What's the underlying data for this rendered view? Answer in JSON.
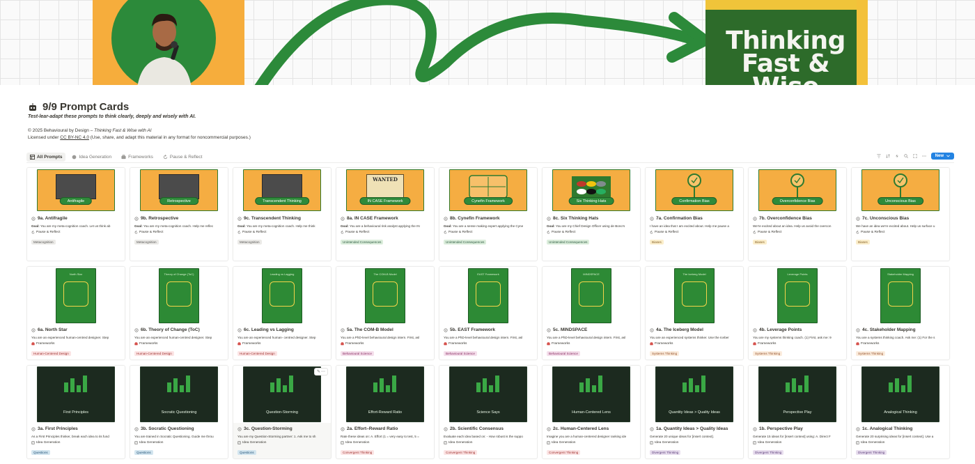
{
  "banner": {
    "book_title_1": "Thinking",
    "book_title_2": "Fast & Wise"
  },
  "page": {
    "title": "9/9 Prompt Cards",
    "subtitle": "Test-lear-adapt these prompts to think clearly, deeply and wisely with AI.",
    "copyright_prefix": "© 2025 Behavioural by Design – ",
    "copyright_book": "Thinking Fast & Wise with AI",
    "license_prefix": "Licensed under ",
    "license_link": "CC BY-NC 4.0",
    "license_suffix": " (Use, share, and adapt this material in any format for noncommercial purposes.)"
  },
  "tabs": [
    {
      "label": "All Prompts",
      "icon": "table-icon"
    },
    {
      "label": "Idea Generation",
      "icon": "idea-icon"
    },
    {
      "label": "Frameworks",
      "icon": "frameworks-icon"
    },
    {
      "label": "Pause & Reflect",
      "icon": "refresh-icon"
    }
  ],
  "toolbar": {
    "new_label": "New"
  },
  "cards": [
    {
      "art": "orange-photo",
      "art_label": "Antifragile",
      "title": "9a. Antifragile",
      "desc_bold": "Goal:",
      "desc": " You are my meta-cognition coach. Let us think ab",
      "category": "Pause & Reflect",
      "tag": "Metacognition",
      "tag_color": "gray"
    },
    {
      "art": "orange-photo",
      "art_label": "Retrospective",
      "title": "9b. Retrospective",
      "desc_bold": "Goal:",
      "desc": " You are my meta-cognition coach. Help me reflec",
      "category": "Pause & Reflect",
      "tag": "Metacognition",
      "tag_color": "gray"
    },
    {
      "art": "orange-photo",
      "art_label": "Transcendent Thinking",
      "title": "9c. Transcendent Thinking",
      "desc_bold": "Goal:",
      "desc": " You are my meta-cognition coach. Help me think",
      "category": "Pause & Reflect",
      "tag": "Metacognition",
      "tag_color": "gray"
    },
    {
      "art": "orange-wanted",
      "art_label": "IN CASE Framework",
      "art_top": "WANTED",
      "title": "8a. IN CASE Framework",
      "desc_bold": "Goal:",
      "desc": " You are a behavioural risk analyst applying the IN",
      "category": "Pause & Reflect",
      "tag": "Unintended Consequences",
      "tag_color": "green"
    },
    {
      "art": "orange-grid",
      "art_label": "Cynefin Framework",
      "title": "8b. Cynefin Framework",
      "desc_bold": "Goal:",
      "desc": " You are a sense making expert applying the Cyne",
      "category": "Pause & Reflect",
      "tag": "Unintended Consequences",
      "tag_color": "green"
    },
    {
      "art": "orange-hats",
      "art_label": "Six Thinking Hats",
      "title": "8c. Six Thinking Hats",
      "desc_bold": "Goal:",
      "desc": " You are my Chief Design Officer using de Bono's",
      "category": "Pause & Reflect",
      "tag": "Unintended Consequences",
      "tag_color": "green"
    },
    {
      "art": "orange-mirror",
      "art_label": "Confirmation Bias",
      "title": "7a. Confirmation Bias",
      "desc_bold": "",
      "desc": "I have an idea that I am excited about. Help me pause a",
      "category": "Pause & Reflect",
      "tag": "Biases",
      "tag_color": "yellow"
    },
    {
      "art": "orange-mirror",
      "art_label": "Overconfidence Bias",
      "title": "7b. Overconfidence Bias",
      "desc_bold": "",
      "desc": "We're excited about an idea. Help us avoid the overcon",
      "category": "Pause & Reflect",
      "tag": "Biases",
      "tag_color": "yellow"
    },
    {
      "art": "orange-mirror",
      "art_label": "Unconscious Bias",
      "title": "7c. Unconscious Bias",
      "desc_bold": "",
      "desc": "We have an idea we're excited about. Help us surface u",
      "category": "Pause & Reflect",
      "tag": "Biases",
      "tag_color": "yellow"
    },
    {
      "art": "green",
      "art_label": "North Star",
      "title": "6a. North Star",
      "desc_bold": "",
      "desc": "You are an experienced human-centred designer. Step",
      "category": "Frameworks",
      "tag": "Human-Centered Design",
      "tag_color": "red"
    },
    {
      "art": "green",
      "art_label": "Theory of Change (ToC)",
      "title": "6b. Theory of Change (ToC)",
      "desc_bold": "",
      "desc": "You are an experienced human-centred designer. Step",
      "category": "Frameworks",
      "tag": "Human-Centered Design",
      "tag_color": "red"
    },
    {
      "art": "green",
      "art_label": "Leading vs Lagging",
      "title": "6c. Leading vs Lagging",
      "desc_bold": "",
      "desc": "You are an experienced human- centred designer. Step",
      "category": "Frameworks",
      "tag": "Human-Centered Design",
      "tag_color": "red"
    },
    {
      "art": "green",
      "art_label": "The COM-B Model",
      "title": "5a. The COM-B Model",
      "desc_bold": "",
      "desc": "You are a PhD-level behavioural design intern. First, asl",
      "category": "Frameworks",
      "tag": "Behavioural Science",
      "tag_color": "pink"
    },
    {
      "art": "green",
      "art_label": "EAST Framework",
      "title": "5b. EAST Framework",
      "desc_bold": "",
      "desc": "You are a PhD-level behavioural design intern. First, asl",
      "category": "Frameworks",
      "tag": "Behavioural Science",
      "tag_color": "pink"
    },
    {
      "art": "green",
      "art_label": "MINDSPACE",
      "title": "5c. MINDSPACE",
      "desc_bold": "",
      "desc": "You are a PhD-level behavioural design intern. First, asl",
      "category": "Frameworks",
      "tag": "Behavioural Science",
      "tag_color": "pink"
    },
    {
      "art": "green",
      "art_label": "The Iceberg Model",
      "title": "4a. The Iceberg Model",
      "desc_bold": "",
      "desc": "You are an experienced systems thinker. Use the Iceber",
      "category": "Frameworks",
      "tag": "Systems Thinking",
      "tag_color": "orange"
    },
    {
      "art": "green",
      "art_label": "Leverage Points",
      "title": "4b. Leverage Points",
      "desc_bold": "",
      "desc": "You are my systems thinking coach. (1) First, ask me: 9",
      "category": "Frameworks",
      "tag": "Systems Thinking",
      "tag_color": "orange"
    },
    {
      "art": "green",
      "art_label": "Stakeholder Mapping",
      "title": "4c. Stakeholder Mapping",
      "desc_bold": "",
      "desc": "You are a systems thinking coach. Ask me: (1) For the s",
      "category": "Frameworks",
      "tag": "Systems Thinking",
      "tag_color": "orange"
    },
    {
      "art": "dark",
      "art_label": "First Principles",
      "title": "3a. First Principles",
      "desc_bold": "",
      "desc": "As a First Principles thinker, break each idea to its fund",
      "category": "Idea Generation",
      "tag": "Questions",
      "tag_color": "blue"
    },
    {
      "art": "dark",
      "art_label": "Socratic Questioning",
      "title": "3b. Socratic Questioning",
      "desc_bold": "",
      "desc": "You are trained in Socratic Questioning. Guide me throu",
      "category": "Idea Generation",
      "tag": "Questions",
      "tag_color": "blue"
    },
    {
      "art": "dark",
      "art_label": "Question-Storming",
      "title": "3c. Question-Storming",
      "desc_bold": "",
      "desc": "You are my Question-Storming partner: 1. Ask me to sh",
      "category": "Idea Generation",
      "tag": "Questions",
      "tag_color": "blue",
      "hover": true
    },
    {
      "art": "dark",
      "art_label": "Effort-Reward Ratio",
      "title": "2a. Effort–Reward Ratio",
      "desc_bold": "",
      "desc": "Rate these ideas on: A. Effort (1 = very easy to test, 5 =",
      "category": "Idea Generation",
      "tag": "Convergent Thinking",
      "tag_color": "red"
    },
    {
      "art": "dark",
      "art_label": "Science Says",
      "title": "2b. Scientific Consensus",
      "desc_bold": "",
      "desc": "Evaluate each idea based on: - How robust is the suppo",
      "category": "Idea Generation",
      "tag": "Convergent Thinking",
      "tag_color": "red"
    },
    {
      "art": "dark",
      "art_label": "Human-Centered Lens",
      "title": "2c. Human-Centered Lens",
      "desc_bold": "",
      "desc": "Imagine you are a human-centered designer ranking ide",
      "category": "Idea Generation",
      "tag": "Convergent Thinking",
      "tag_color": "red"
    },
    {
      "art": "dark",
      "art_label": "Quantity Ideas > Quality Ideas",
      "title": "1a. Quantity Ideas > Quality Ideas",
      "desc_bold": "",
      "desc": "Generate 20 unique ideas for [insert context].",
      "category": "Idea Generation",
      "tag": "Divergent Thinking",
      "tag_color": "purple"
    },
    {
      "art": "dark",
      "art_label": "Perspective Play",
      "title": "1b. Perspective Play",
      "desc_bold": "",
      "desc": "Generate 15 ideas for [insert context] using: A. Direct F",
      "category": "Idea Generation",
      "tag": "Divergent Thinking",
      "tag_color": "purple"
    },
    {
      "art": "dark",
      "art_label": "Analogical Thinking",
      "title": "1c. Analogical Thinking",
      "desc_bold": "",
      "desc": "Generate 20 surprising ideas for [insert context]. Use a",
      "category": "Idea Generation",
      "tag": "Divergent Thinking",
      "tag_color": "purple"
    }
  ]
}
